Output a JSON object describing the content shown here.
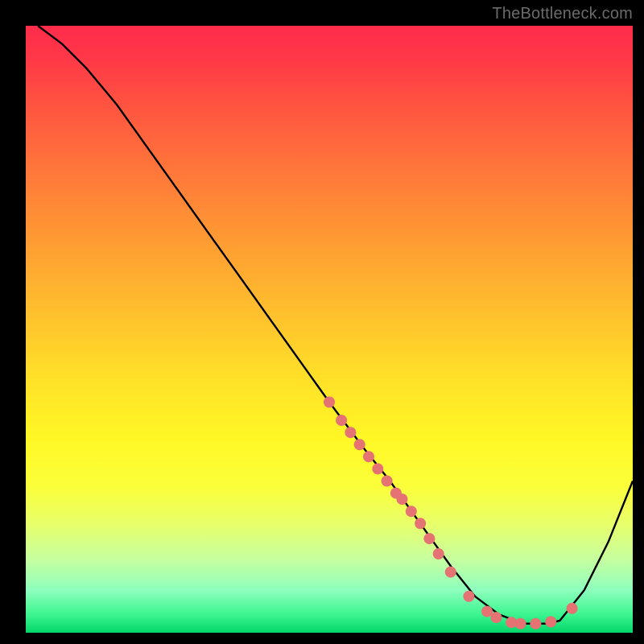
{
  "watermark": "TheBottleneck.com",
  "chart_data": {
    "type": "line",
    "title": "",
    "xlabel": "",
    "ylabel": "",
    "xlim": [
      0,
      100
    ],
    "ylim": [
      0,
      100
    ],
    "grid": false,
    "legend": false,
    "series": [
      {
        "name": "curve",
        "x": [
          2,
          6,
          10,
          15,
          20,
          25,
          30,
          35,
          40,
          45,
          50,
          53,
          56,
          60,
          65,
          70,
          74,
          78,
          82,
          86,
          88,
          92,
          96,
          100
        ],
        "y": [
          100,
          97,
          93,
          87,
          80,
          73,
          66,
          59,
          52,
          45,
          38,
          34,
          30,
          25,
          18,
          11,
          6,
          3,
          1.5,
          1.5,
          2,
          7,
          15,
          25
        ]
      }
    ],
    "markers": [
      {
        "x": 50,
        "y": 38
      },
      {
        "x": 52,
        "y": 35
      },
      {
        "x": 53.5,
        "y": 33
      },
      {
        "x": 55,
        "y": 31
      },
      {
        "x": 56.5,
        "y": 29
      },
      {
        "x": 58,
        "y": 27
      },
      {
        "x": 59.5,
        "y": 25
      },
      {
        "x": 61,
        "y": 23
      },
      {
        "x": 62,
        "y": 22
      },
      {
        "x": 63.5,
        "y": 20
      },
      {
        "x": 65,
        "y": 18
      },
      {
        "x": 66.5,
        "y": 15.5
      },
      {
        "x": 68,
        "y": 13
      },
      {
        "x": 70,
        "y": 10
      },
      {
        "x": 73,
        "y": 6
      },
      {
        "x": 76,
        "y": 3.5
      },
      {
        "x": 77.5,
        "y": 2.5
      },
      {
        "x": 80,
        "y": 1.7
      },
      {
        "x": 81.5,
        "y": 1.5
      },
      {
        "x": 84,
        "y": 1.5
      },
      {
        "x": 86.5,
        "y": 1.8
      },
      {
        "x": 90,
        "y": 4
      }
    ],
    "marker_style": {
      "shape": "circle",
      "radius": 7,
      "fill": "#e57373",
      "stroke": "none"
    },
    "curve_style": {
      "stroke": "#000000",
      "width": 2.4
    }
  }
}
